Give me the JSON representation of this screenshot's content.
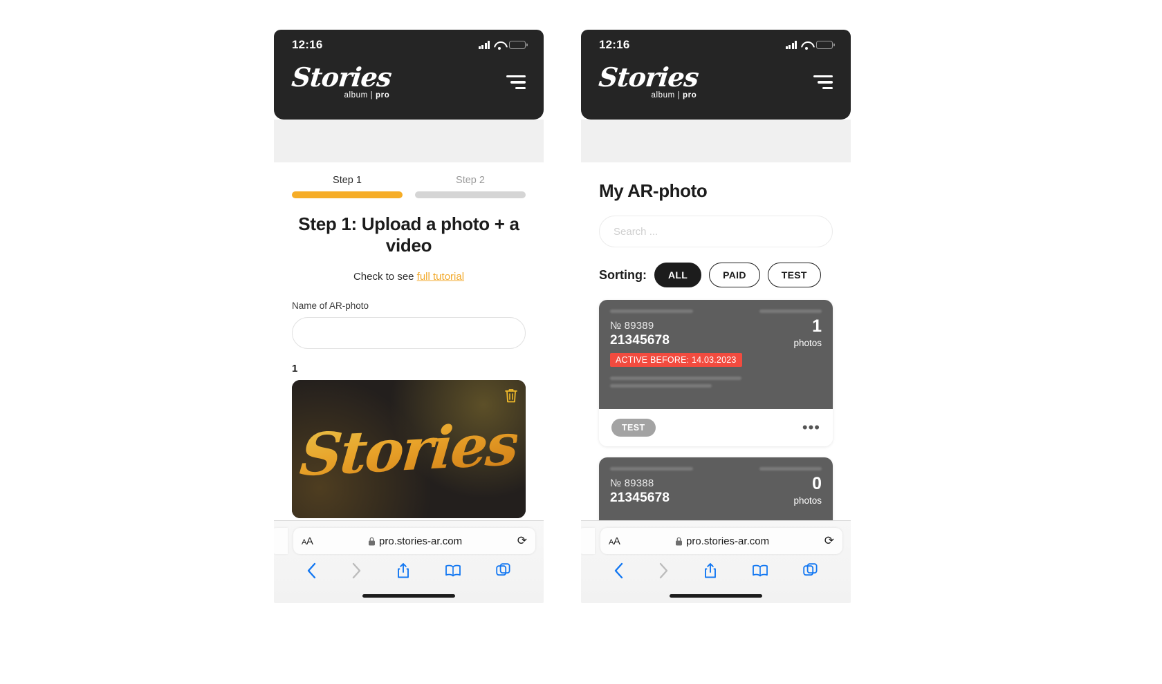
{
  "status_bar": {
    "time": "12:16",
    "signal_icon": "cellular-bars-icon",
    "wifi_icon": "wifi-icon",
    "battery_icon": "battery-icon"
  },
  "brand": {
    "word": "Stories",
    "sub_album": "album",
    "sub_sep": "|",
    "sub_pro": "pro",
    "menu_icon": "hamburger-menu-icon"
  },
  "left_screen": {
    "steps": [
      {
        "label": "Step 1",
        "active": true
      },
      {
        "label": "Step 2",
        "active": false
      }
    ],
    "heading": "Step 1: Upload a photo + a video",
    "tutorial_prefix": "Check to see",
    "tutorial_link": "full tutorial",
    "field_label": "Name of AR-photo",
    "field_value": "",
    "field_placeholder": "",
    "slot_index": "1",
    "thumb_text": "Stories",
    "delete_icon": "trash-icon",
    "fab_icon": "chat-bubble-icon"
  },
  "right_screen": {
    "title": "My AR-photo",
    "search_placeholder": "Search ...",
    "search_value": "",
    "sorting_label": "Sorting:",
    "sorting_options": [
      {
        "label": "ALL",
        "selected": true
      },
      {
        "label": "PAID",
        "selected": false
      },
      {
        "label": "TEST",
        "selected": false
      }
    ],
    "cards": [
      {
        "number": "№ 89389",
        "code": "21345678",
        "badge": "ACTIVE BEFORE: 14.03.2023",
        "count": "1",
        "count_unit": "photos",
        "tag": "TEST",
        "more_icon": "ellipsis-icon"
      },
      {
        "number": "№ 89388",
        "code": "21345678",
        "badge": "",
        "count": "0",
        "count_unit": "photos",
        "tag": "",
        "more_icon": "ellipsis-icon"
      }
    ],
    "fab_icon": "chat-bubble-icon"
  },
  "safari": {
    "text_size_label": "AA",
    "lock_icon": "lock-icon",
    "url": "pro.stories-ar.com",
    "reload_icon": "reload-icon",
    "toolbar": [
      {
        "name": "back-button",
        "icon": "chevron-left-icon",
        "enabled": true
      },
      {
        "name": "forward-button",
        "icon": "chevron-right-icon",
        "enabled": false
      },
      {
        "name": "share-button",
        "icon": "share-icon",
        "enabled": true
      },
      {
        "name": "bookmarks-button",
        "icon": "book-icon",
        "enabled": true
      },
      {
        "name": "tabs-button",
        "icon": "tabs-icon",
        "enabled": true
      }
    ]
  },
  "colors": {
    "accent": "#f6a623",
    "dark": "#252525",
    "danger": "#f24b3f",
    "link": "#f2a92b",
    "safari_blue": "#1277f2"
  }
}
